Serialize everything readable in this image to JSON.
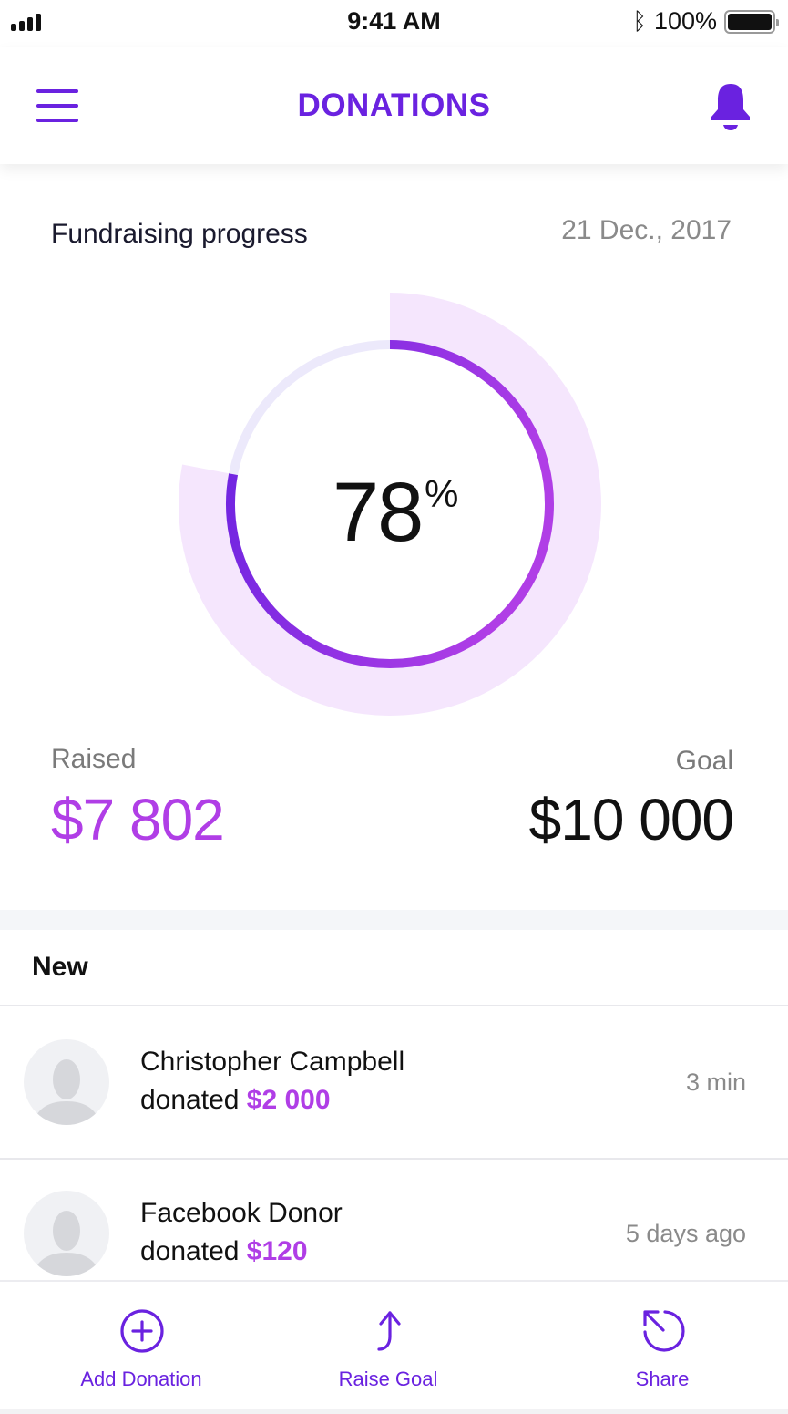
{
  "status_bar": {
    "time": "9:41 AM",
    "battery_text": "100%",
    "bluetooth_icon": "bluetooth-icon",
    "signal_icon": "signal-bars-icon",
    "battery_icon": "battery-full-icon"
  },
  "nav": {
    "title": "DONATIONS",
    "menu_icon": "hamburger-menu-icon",
    "notification_icon": "bell-icon"
  },
  "progress": {
    "title": "Fundraising progress",
    "date": "21 Dec., 2017",
    "percent_value": "78",
    "percent_sign": "%",
    "percent_fraction": 0.78,
    "raised_label": "Raised",
    "raised_value": "$7 802",
    "goal_label": "Goal",
    "goal_value": "$10 000"
  },
  "donations": {
    "section_title": "New",
    "items": [
      {
        "name": "Christopher Campbell",
        "verb": "donated",
        "amount": "$2 000",
        "time": "3 min"
      },
      {
        "name": "Facebook Donor",
        "verb": "donated",
        "amount": "$120",
        "time": "5 days ago"
      }
    ]
  },
  "tab_bar": {
    "tabs": [
      {
        "label": "Add Donation",
        "icon": "plus-circle-icon"
      },
      {
        "label": "Raise Goal",
        "icon": "arrow-up-curve-icon"
      },
      {
        "label": "Share",
        "icon": "share-arrow-icon"
      }
    ]
  },
  "colors": {
    "accent": "#6a22e0",
    "accent_pink": "#b03ee6",
    "band": "#f5e6fd",
    "track": "#ece9fb"
  }
}
